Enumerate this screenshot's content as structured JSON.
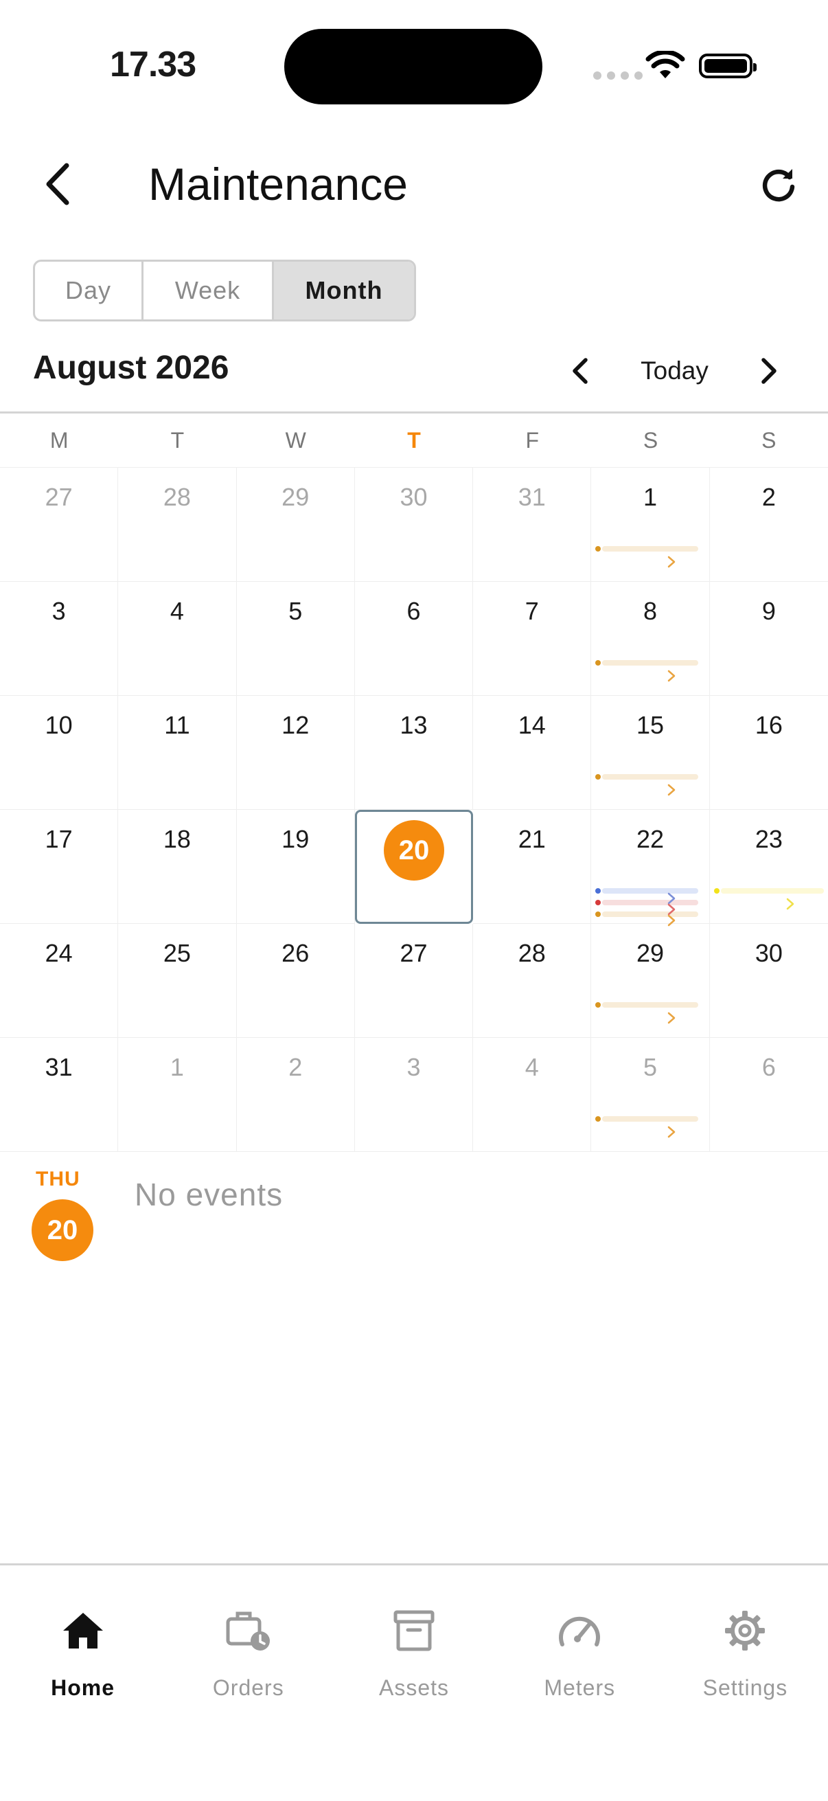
{
  "status": {
    "time": "17.33"
  },
  "header": {
    "title": "Maintenance"
  },
  "view_modes": {
    "day": "Day",
    "week": "Week",
    "month": "Month",
    "selected": "Month"
  },
  "calendar": {
    "month_title": "August 2026",
    "today_label": "Today",
    "weekdays": [
      "M",
      "T",
      "W",
      "T",
      "F",
      "S",
      "S"
    ],
    "today_weekday_index": 3,
    "days": [
      "27",
      "28",
      "29",
      "30",
      "31",
      "1",
      "2",
      "3",
      "4",
      "5",
      "6",
      "7",
      "8",
      "9",
      "10",
      "11",
      "12",
      "13",
      "14",
      "15",
      "16",
      "17",
      "18",
      "19",
      "20",
      "21",
      "22",
      "23",
      "24",
      "25",
      "26",
      "27",
      "28",
      "29",
      "30",
      "31",
      "1",
      "2",
      "3",
      "4",
      "5",
      "6"
    ],
    "selected_day": "20",
    "event_colors": {
      "orange": "#d99520",
      "blue": "#4a6fd6",
      "red": "#d63b3b",
      "yellow": "#f2e21a"
    }
  },
  "selected": {
    "weekday": "THU",
    "day": "20",
    "empty_text": "No events"
  },
  "tabbar": {
    "items": [
      {
        "label": "Home",
        "icon": "home-icon",
        "active": true
      },
      {
        "label": "Orders",
        "icon": "briefcase-clock-icon",
        "active": false
      },
      {
        "label": "Assets",
        "icon": "archive-box-icon",
        "active": false
      },
      {
        "label": "Meters",
        "icon": "speedometer-icon",
        "active": false
      },
      {
        "label": "Settings",
        "icon": "gear-icon",
        "active": false
      }
    ]
  },
  "colors": {
    "accent": "#f58b0e",
    "selected_border": "#6e8795"
  }
}
